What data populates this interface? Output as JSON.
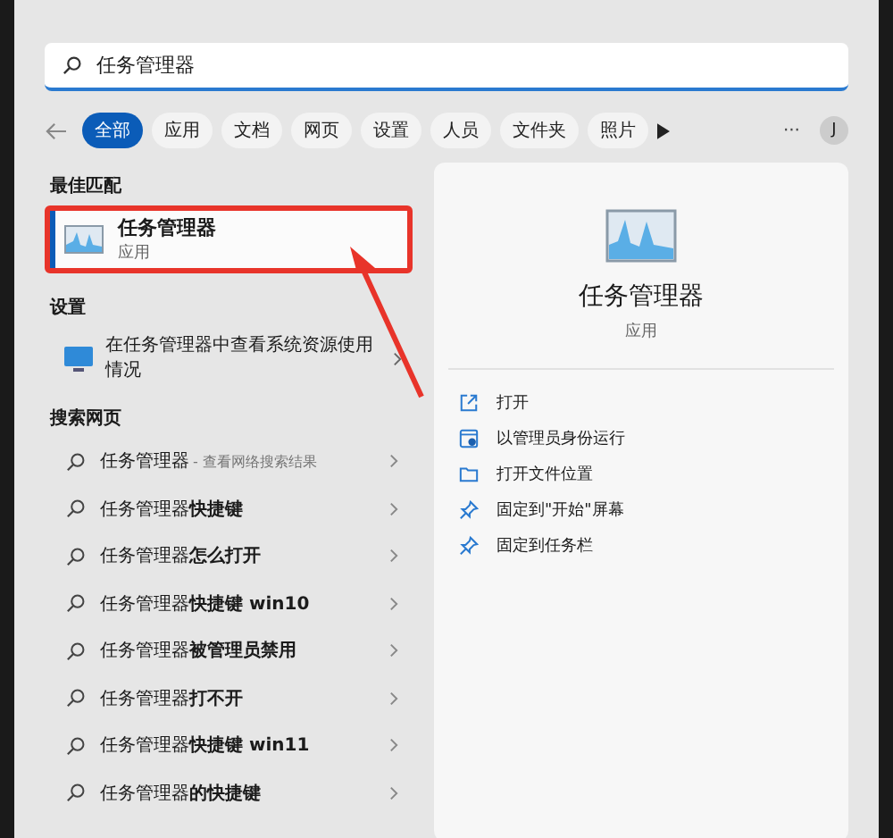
{
  "search": {
    "value": "任务管理器"
  },
  "filters": [
    {
      "label": "全部",
      "selected": true
    },
    {
      "label": "应用",
      "selected": false
    },
    {
      "label": "文档",
      "selected": false
    },
    {
      "label": "网页",
      "selected": false
    },
    {
      "label": "设置",
      "selected": false
    },
    {
      "label": "人员",
      "selected": false
    },
    {
      "label": "文件夹",
      "selected": false
    },
    {
      "label": "照片",
      "selected": false
    }
  ],
  "more": "···",
  "avatar": "J",
  "best_match": {
    "heading": "最佳匹配",
    "title": "任务管理器",
    "subtitle": "应用",
    "selected": true
  },
  "settings": {
    "heading": "设置",
    "text": "在任务管理器中查看系统资源使用情况"
  },
  "web": {
    "heading": "搜索网页",
    "items": [
      {
        "text": "任务管理器",
        "hint": "- 查看网络搜索结果"
      },
      {
        "text": "任务管理器**快捷键**"
      },
      {
        "text": "任务管理器**怎么打开**"
      },
      {
        "text": "任务管理器**快捷键 win10**"
      },
      {
        "text": "任务管理器**被管理员禁用**"
      },
      {
        "text": "任务管理器**打不开**"
      },
      {
        "text": "任务管理器**快捷键 win11**"
      },
      {
        "text": "任务管理器**的快捷键**"
      }
    ]
  },
  "detail": {
    "title": "任务管理器",
    "subtitle": "应用",
    "actions": [
      {
        "kind": "open",
        "label": "打开"
      },
      {
        "kind": "admin",
        "label": "以管理员身份运行"
      },
      {
        "kind": "folder",
        "label": "打开文件位置"
      },
      {
        "kind": "pin",
        "label": "固定到\"开始\"屏幕"
      },
      {
        "kind": "pin",
        "label": "固定到任务栏"
      }
    ]
  }
}
